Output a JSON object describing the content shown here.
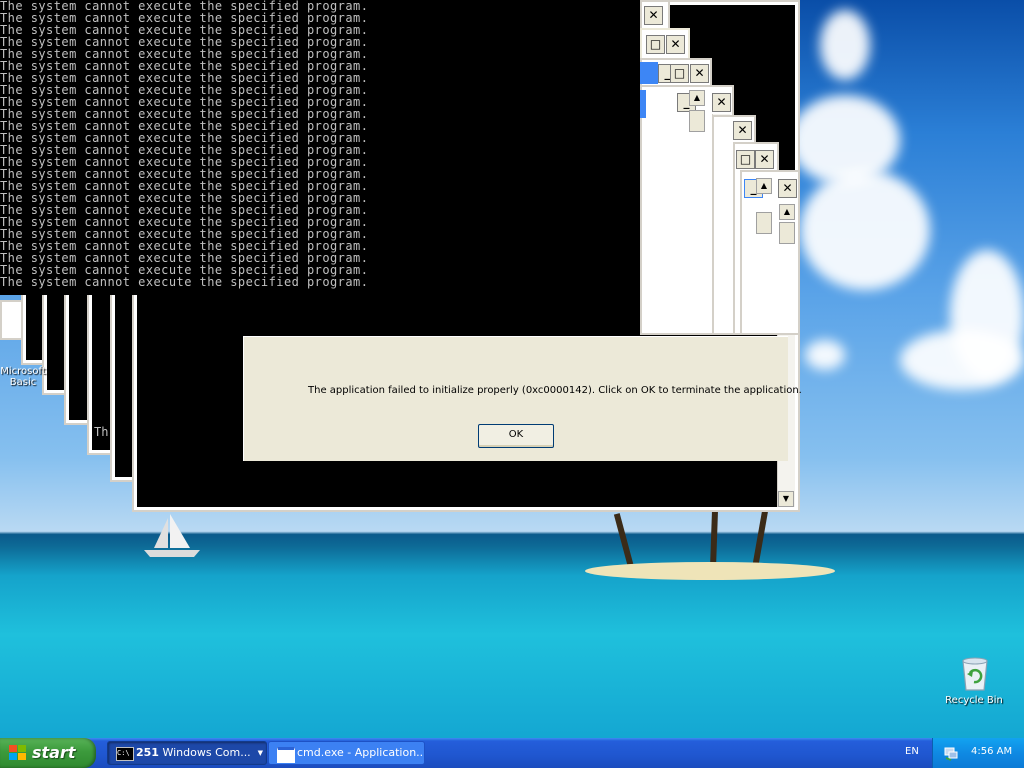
{
  "console": {
    "line": "The system cannot execute the specified program.",
    "line_count": 24
  },
  "dialog": {
    "message": "The application failed to initialize properly (0xc0000142). Click on OK to terminate the application.",
    "ok_label": "OK"
  },
  "desktop": {
    "left_icon_label_1": "Microsoft",
    "left_icon_label_2": "Basic",
    "partial_text": "Th",
    "recycle_bin_label": "Recycle Bin"
  },
  "window_buttons": {
    "minimize": "_",
    "maximize": "□",
    "close": "✕",
    "scroll_up": "▲",
    "scroll_down": "▼"
  },
  "taskbar": {
    "start_label": "start",
    "task1_count": "251",
    "task1_label": "Windows Com...",
    "task1_icon_text": "C:\\",
    "task2_label": "cmd.exe - Application...",
    "language": "EN",
    "clock": "4:56 AM"
  },
  "colors": {
    "taskbar_blue": "#245edb",
    "start_green": "#3c9a3c",
    "dialog_bg": "#ece9d8",
    "console_text": "#c0c0c0"
  }
}
